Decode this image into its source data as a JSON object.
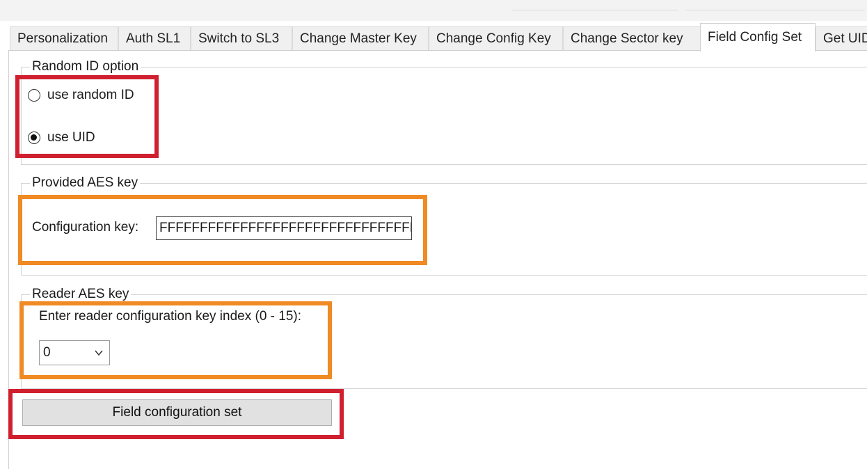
{
  "tabs": [
    {
      "label": "Personalization",
      "active": false
    },
    {
      "label": "Auth SL1",
      "active": false
    },
    {
      "label": "Switch to SL3",
      "active": false
    },
    {
      "label": "Change Master Key",
      "active": false
    },
    {
      "label": "Change Config Key",
      "active": false
    },
    {
      "label": "Change Sector key",
      "active": false
    },
    {
      "label": "Field Config Set",
      "active": true
    },
    {
      "label": "Get UID",
      "active": false
    }
  ],
  "random_id": {
    "legend": "Random ID option",
    "option_random": "use random ID",
    "option_uid": "use UID",
    "selected": "use UID"
  },
  "provided_key": {
    "legend": "Provided AES key",
    "label": "Configuration key:",
    "value": "FFFFFFFFFFFFFFFFFFFFFFFFFFFFFFFF"
  },
  "reader_key": {
    "legend": "Reader AES key",
    "label": "Enter reader configuration key index (0 - 15):",
    "selected_index": "0"
  },
  "action": {
    "button_label": "Field configuration set"
  },
  "colors": {
    "highlight_red": "#d0202f",
    "highlight_orange": "#f08a24"
  }
}
